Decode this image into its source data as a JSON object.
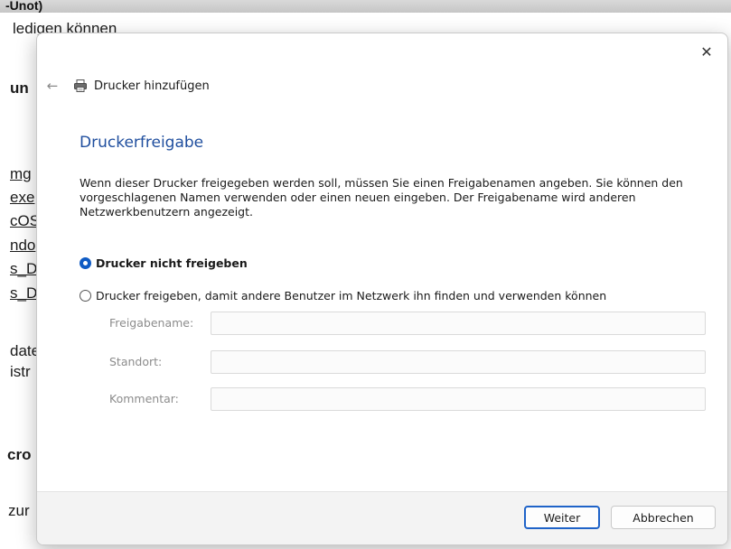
{
  "background_page": {
    "cut_heading": "-Unot)",
    "line_erledigen": "ledigen können",
    "fragment_un": "un",
    "fragments_links": [
      "mg",
      "exe",
      "cOS",
      "ndo",
      "s_D",
      "s_D"
    ],
    "fragments_text": [
      "date",
      "istr"
    ],
    "fragment_cro": "cro",
    "fragment_zur": "zur"
  },
  "dialog": {
    "close_glyph": "✕",
    "back_glyph": "←",
    "title": "Drucker hinzufügen",
    "section_title": "Druckerfreigabe",
    "description": "Wenn dieser Drucker freigegeben werden soll, müssen Sie einen Freigabenamen angeben. Sie können den vorgeschlagenen Namen verwenden oder einen neuen eingeben. Der Freigabename wird anderen Netzwerkbenutzern angezeigt.",
    "options": {
      "no_share": {
        "label": "Drucker nicht freigeben",
        "checked": true
      },
      "share": {
        "label": "Drucker freigeben, damit andere Benutzer im Netzwerk ihn finden und verwenden können",
        "checked": false
      }
    },
    "fields": {
      "share_name": {
        "label": "Freigabename:",
        "value": ""
      },
      "location": {
        "label": "Standort:",
        "value": ""
      },
      "comment": {
        "label": "Kommentar:",
        "value": ""
      }
    },
    "buttons": {
      "next": "Weiter",
      "cancel": "Abbrechen"
    }
  },
  "colors": {
    "accent": "#0f5bc4",
    "section_title": "#1f4e9e",
    "footer_bg": "#f3f3f3"
  },
  "icons": {
    "close": "close-icon",
    "back": "back-arrow-icon",
    "printer": "printer-icon"
  }
}
